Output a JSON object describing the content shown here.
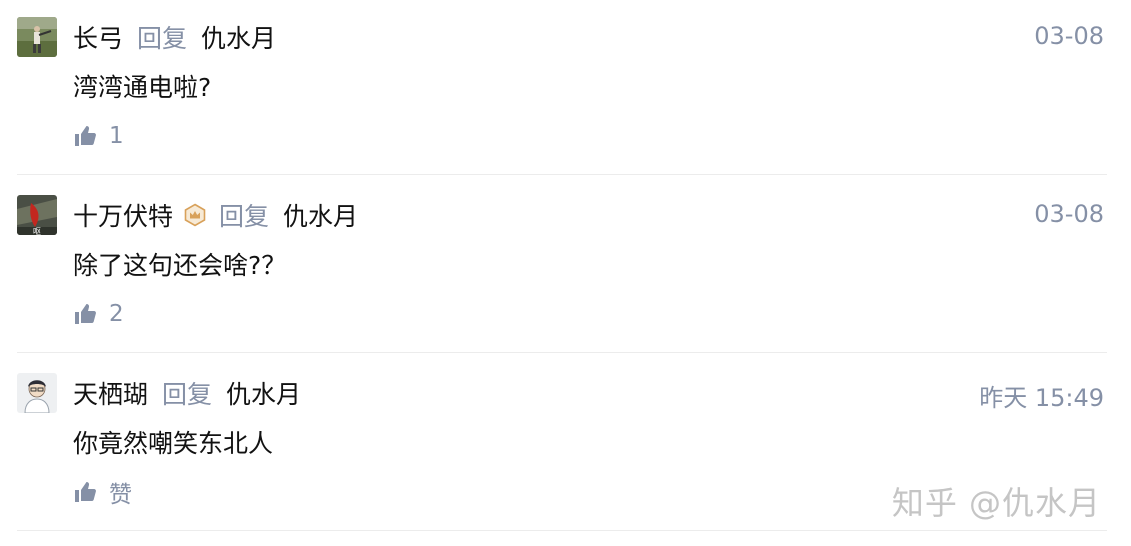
{
  "comments": [
    {
      "author": "长弓",
      "reply_label": "回复",
      "reply_to": "仇水月",
      "time": "03-08",
      "content": "湾湾通电啦?",
      "likes": "1"
    },
    {
      "author": "十万伏特",
      "reply_label": "回复",
      "reply_to": "仇水月",
      "time": "03-08",
      "content": "除了这句还会啥?？",
      "likes": "2",
      "avatar_label": "呕"
    },
    {
      "author": "天栖瑚",
      "reply_label": "回复",
      "reply_to": "仇水月",
      "time": "昨天 15:49",
      "content": "你竟然嘲笑东北人",
      "likes": "赞"
    }
  ],
  "watermark": "知乎 @仇水月",
  "colors": {
    "text": "#121212",
    "muted": "#8590a6",
    "divider": "#ececec",
    "badge": "#d8a15a"
  }
}
